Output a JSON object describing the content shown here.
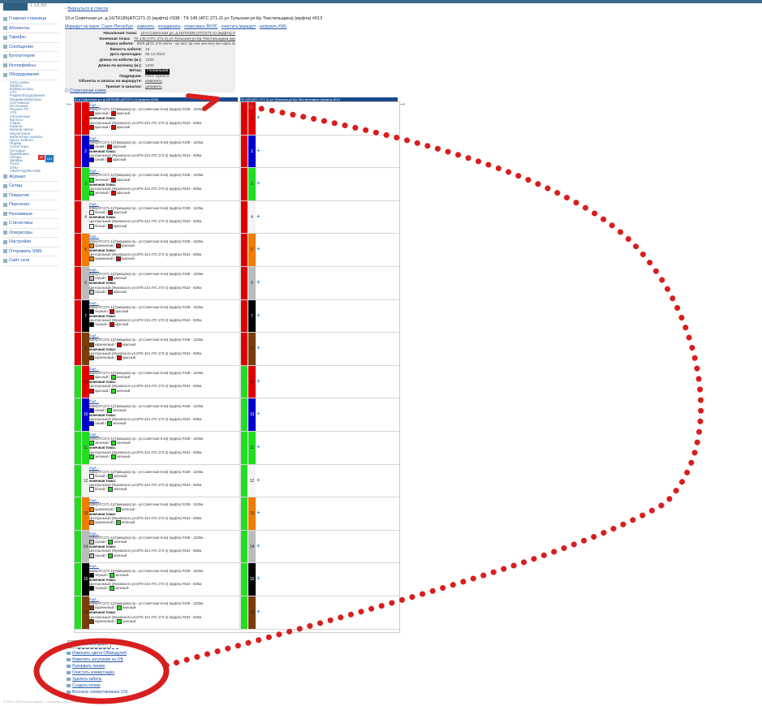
{
  "app": {
    "version": "1.14.60"
  },
  "sidebar": {
    "items": [
      {
        "label": "Главная страница",
        "icon": "home-icon"
      },
      {
        "label": "Абоненты",
        "icon": "users-icon"
      },
      {
        "label": "Тарифы",
        "icon": "tariff-icon"
      },
      {
        "label": "Сообщения",
        "icon": "message-icon"
      },
      {
        "label": "Бухгалтерия",
        "icon": "accounting-icon"
      },
      {
        "label": "Интерфейсы",
        "icon": "interface-icon"
      },
      {
        "label": "Оборудование",
        "icon": "equipment-icon"
      }
    ],
    "equipment_sub": [
      "Узлы связи",
      "Муфты",
      "Коммутаторы",
      "ATC",
      "Радиооборудование",
      "Медиаконвертеры",
      "Системные",
      "Источники",
      "Разные ТП",
      "ATS",
      "Оптические",
      "Кроссы",
      "Связи",
      "Кабели",
      "Кабели связи",
      "Магистрали",
      "Кабельные каналы",
      "Кросс-кабели",
      "Ящики",
      "Сплиттеры",
      "Колодцы",
      "Приёмники",
      "Опоры",
      "Шкафы",
      "Tovar",
      "ONU",
      "ОБОРУДОВАНИЕ"
    ],
    "items2": [
      {
        "label": "Журнал",
        "icon": "journal-icon"
      },
      {
        "label": "Склад",
        "icon": "warehouse-icon"
      },
      {
        "label": "Покрытие",
        "icon": "coverage-icon"
      },
      {
        "label": "Персонал",
        "icon": "staff-icon"
      },
      {
        "label": "Рекламные",
        "icon": "ads-icon"
      },
      {
        "label": "Статистика",
        "icon": "stats-icon"
      },
      {
        "label": "Операторы",
        "icon": "operators-icon"
      },
      {
        "label": "Настройки",
        "icon": "settings-icon"
      },
      {
        "label": "Отправить SMS",
        "icon": "sms-icon"
      },
      {
        "label": "Сайт сети",
        "icon": "site-icon"
      }
    ],
    "badge_red": "88",
    "badge_blue": "181"
  },
  "main": {
    "back": "Вернуться в список",
    "title": "10-я Советская ул. д.16/ТК185(АТС271-2) (муфта) #338 - ТК 145 (АТС 271-2) ул.Тульская-ул.Кр.Текстильщика) (муфта) #613",
    "map_links": [
      "Маршрут на карте: Санкт-Петербург",
      "изменить",
      "координаты",
      "отрисовать ВОЛС",
      "очистить маршрут",
      "загрузить KML"
    ],
    "props": [
      {
        "label": "Начальная точка:",
        "value": "10-я Советская ул. д.16/ТК185 (АТС271-2) (муфта) #338"
      },
      {
        "label": "Конечная точка:",
        "value": "ТК 145 (АТС 271-2) ул.Тульская-ул.Кр.Текстильщика (муфта) #613"
      },
      {
        "label": "Марка кабеля:",
        "value": "ВОК-ДПС-2*8 (нити - кр.зел; кр.син.зел.бел.бел.фио.бир.нар)"
      },
      {
        "label": "Ёмкость кабеля:",
        "value": "16"
      },
      {
        "label": "Дата прокладки:",
        "value": "05.12.2013"
      },
      {
        "label": "Длина по кабелю (м.):",
        "value": "1200"
      },
      {
        "label": "Длина по волокну (м.):",
        "value": "1200"
      },
      {
        "label": "Метка:",
        "value": "Глобальная"
      },
      {
        "label": "Подрядчик:",
        "value": "ООО Орбита"
      },
      {
        "label": "Объекты и запасы на маршруте:",
        "value": "изменить"
      },
      {
        "label": "Транзит в каналах:",
        "value": "добавить"
      }
    ],
    "structure": "Структурная схема",
    "left_header": "10-я Советская ул. д.16/ТК185 (АТС271-2) (муфта) #338",
    "right_header": "ТК 145 (АТС 271-2) ул.Тульская-ул.Кр.Текстильщика (муфта) #613",
    "fibers": [
      {
        "n": "1",
        "tube": "#e00000",
        "color": "#e00000",
        "cname": "красный",
        "tname": "красный"
      },
      {
        "n": "2",
        "tube": "#e00000",
        "color": "#0000cc",
        "cname": "синий",
        "tname": "красный"
      },
      {
        "n": "3",
        "tube": "#e00000",
        "color": "#22dd22",
        "cname": "зеленый",
        "tname": "красный"
      },
      {
        "n": "4",
        "tube": "#e00000",
        "color": "#ffffff",
        "cname": "белый",
        "tname": "красный"
      },
      {
        "n": "5",
        "tube": "#e00000",
        "color": "#f07c00",
        "cname": "оранжевый",
        "tname": "красный"
      },
      {
        "n": "6",
        "tube": "#e00000",
        "color": "#bbbbbb",
        "cname": "серый",
        "tname": "красный"
      },
      {
        "n": "7",
        "tube": "#e00000",
        "color": "#000000",
        "cname": "черный",
        "tname": "красный"
      },
      {
        "n": "8",
        "tube": "#e00000",
        "color": "#7a3e0c",
        "cname": "коричневый",
        "tname": "красный"
      },
      {
        "n": "9",
        "tube": "#22dd22",
        "color": "#e00000",
        "cname": "красный",
        "tname": "зеленый"
      },
      {
        "n": "10",
        "tube": "#22dd22",
        "color": "#0000cc",
        "cname": "синий",
        "tname": "зеленый"
      },
      {
        "n": "11",
        "tube": "#22dd22",
        "color": "#22dd22",
        "cname": "зеленый",
        "tname": "зеленый"
      },
      {
        "n": "12",
        "tube": "#22dd22",
        "color": "#ffffff",
        "cname": "белый",
        "tname": "зеленый"
      },
      {
        "n": "13",
        "tube": "#22dd22",
        "color": "#f07c00",
        "cname": "оранжевый",
        "tname": "зеленый"
      },
      {
        "n": "14",
        "tube": "#22dd22",
        "color": "#bbbbbb",
        "cname": "серый",
        "tname": "зеленый"
      },
      {
        "n": "15",
        "tube": "#22dd22",
        "color": "#000000",
        "cname": "черный",
        "tname": "зеленый"
      },
      {
        "n": "16",
        "tube": "#22dd22",
        "color": "#7a3e0c",
        "cname": "коричневый",
        "tname": "зеленый"
      }
    ],
    "fiber_text": {
      "prefix": "Ещё...",
      "start": "ВЗМ(АТС271-1)(Гривцова) пр.- ул.Советская 8-ая) (муфта) #339 - 1100м.",
      "end_label": "конечная точка:",
      "end": "Центральный (Жуковского ул.8/ТК 224 АТС 272-2) (муфта) #524 - 830м."
    }
  },
  "actions": {
    "attach": "Прикрепить файл",
    "items": [
      "Изменить цвета ОВ/модулей",
      "Изменить затухания на ОВ",
      "Разорвать линию",
      "Очистить коммутацию",
      "Удалить кабель",
      "Создать копию",
      "Волокна: коммутировано (16)"
    ]
  },
  "footer": "© 2012–2024 (Сеть связи) — Система учета технической документации"
}
